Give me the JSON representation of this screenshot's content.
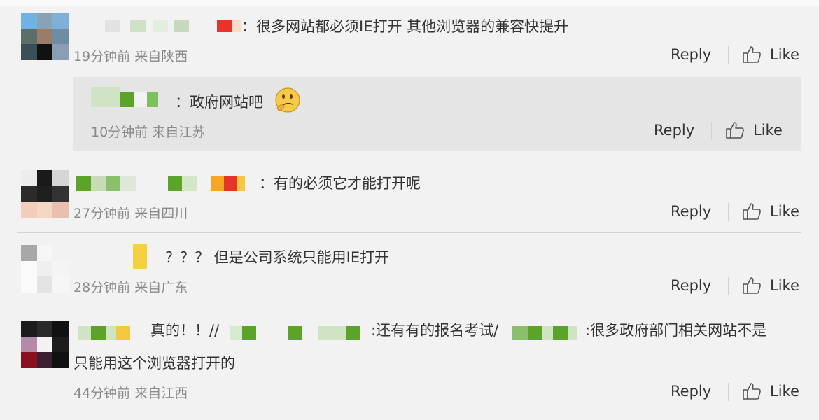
{
  "comments": [
    {
      "text": "：很多网站都必须IE打开 其他浏览器的兼容快提升",
      "time": "19分钟前",
      "location": "来自陕西",
      "reply_label": "Reply",
      "like_label": "Like",
      "replies": [
        {
          "text": "：政府网站吧",
          "time": "10分钟前",
          "location": "来自江苏",
          "reply_label": "Reply",
          "like_label": "Like",
          "emoji": "thinking-face-icon"
        }
      ]
    },
    {
      "text": "：有的必须它才能打开呢",
      "time": "27分钟前",
      "location": "来自四川",
      "reply_label": "Reply",
      "like_label": "Like"
    },
    {
      "text": "？？？ 但是公司系统只能用IE打开",
      "time": "28分钟前",
      "location": "来自广东",
      "reply_label": "Reply",
      "like_label": "Like"
    },
    {
      "text_line1_a": "真的！！//",
      "text_line1_b": ":还有有的报名考试/",
      "text_line1_c": ":很多政府部门相关网站不是",
      "text_line2": "只能用这个浏览器打开的",
      "time": "44分钟前",
      "location": "来自江西",
      "reply_label": "Reply",
      "like_label": "Like"
    }
  ],
  "colors": {
    "background": "#f2f2f2",
    "sub_reply_background": "#e5e5e5",
    "meta_text": "#8a8a8a",
    "pixel_green": "#6fa82a",
    "pixel_red": "#e8332a",
    "pixel_yellow": "#f5c842"
  },
  "icons": [
    "thumbs-up-icon",
    "thinking-face-icon"
  ]
}
